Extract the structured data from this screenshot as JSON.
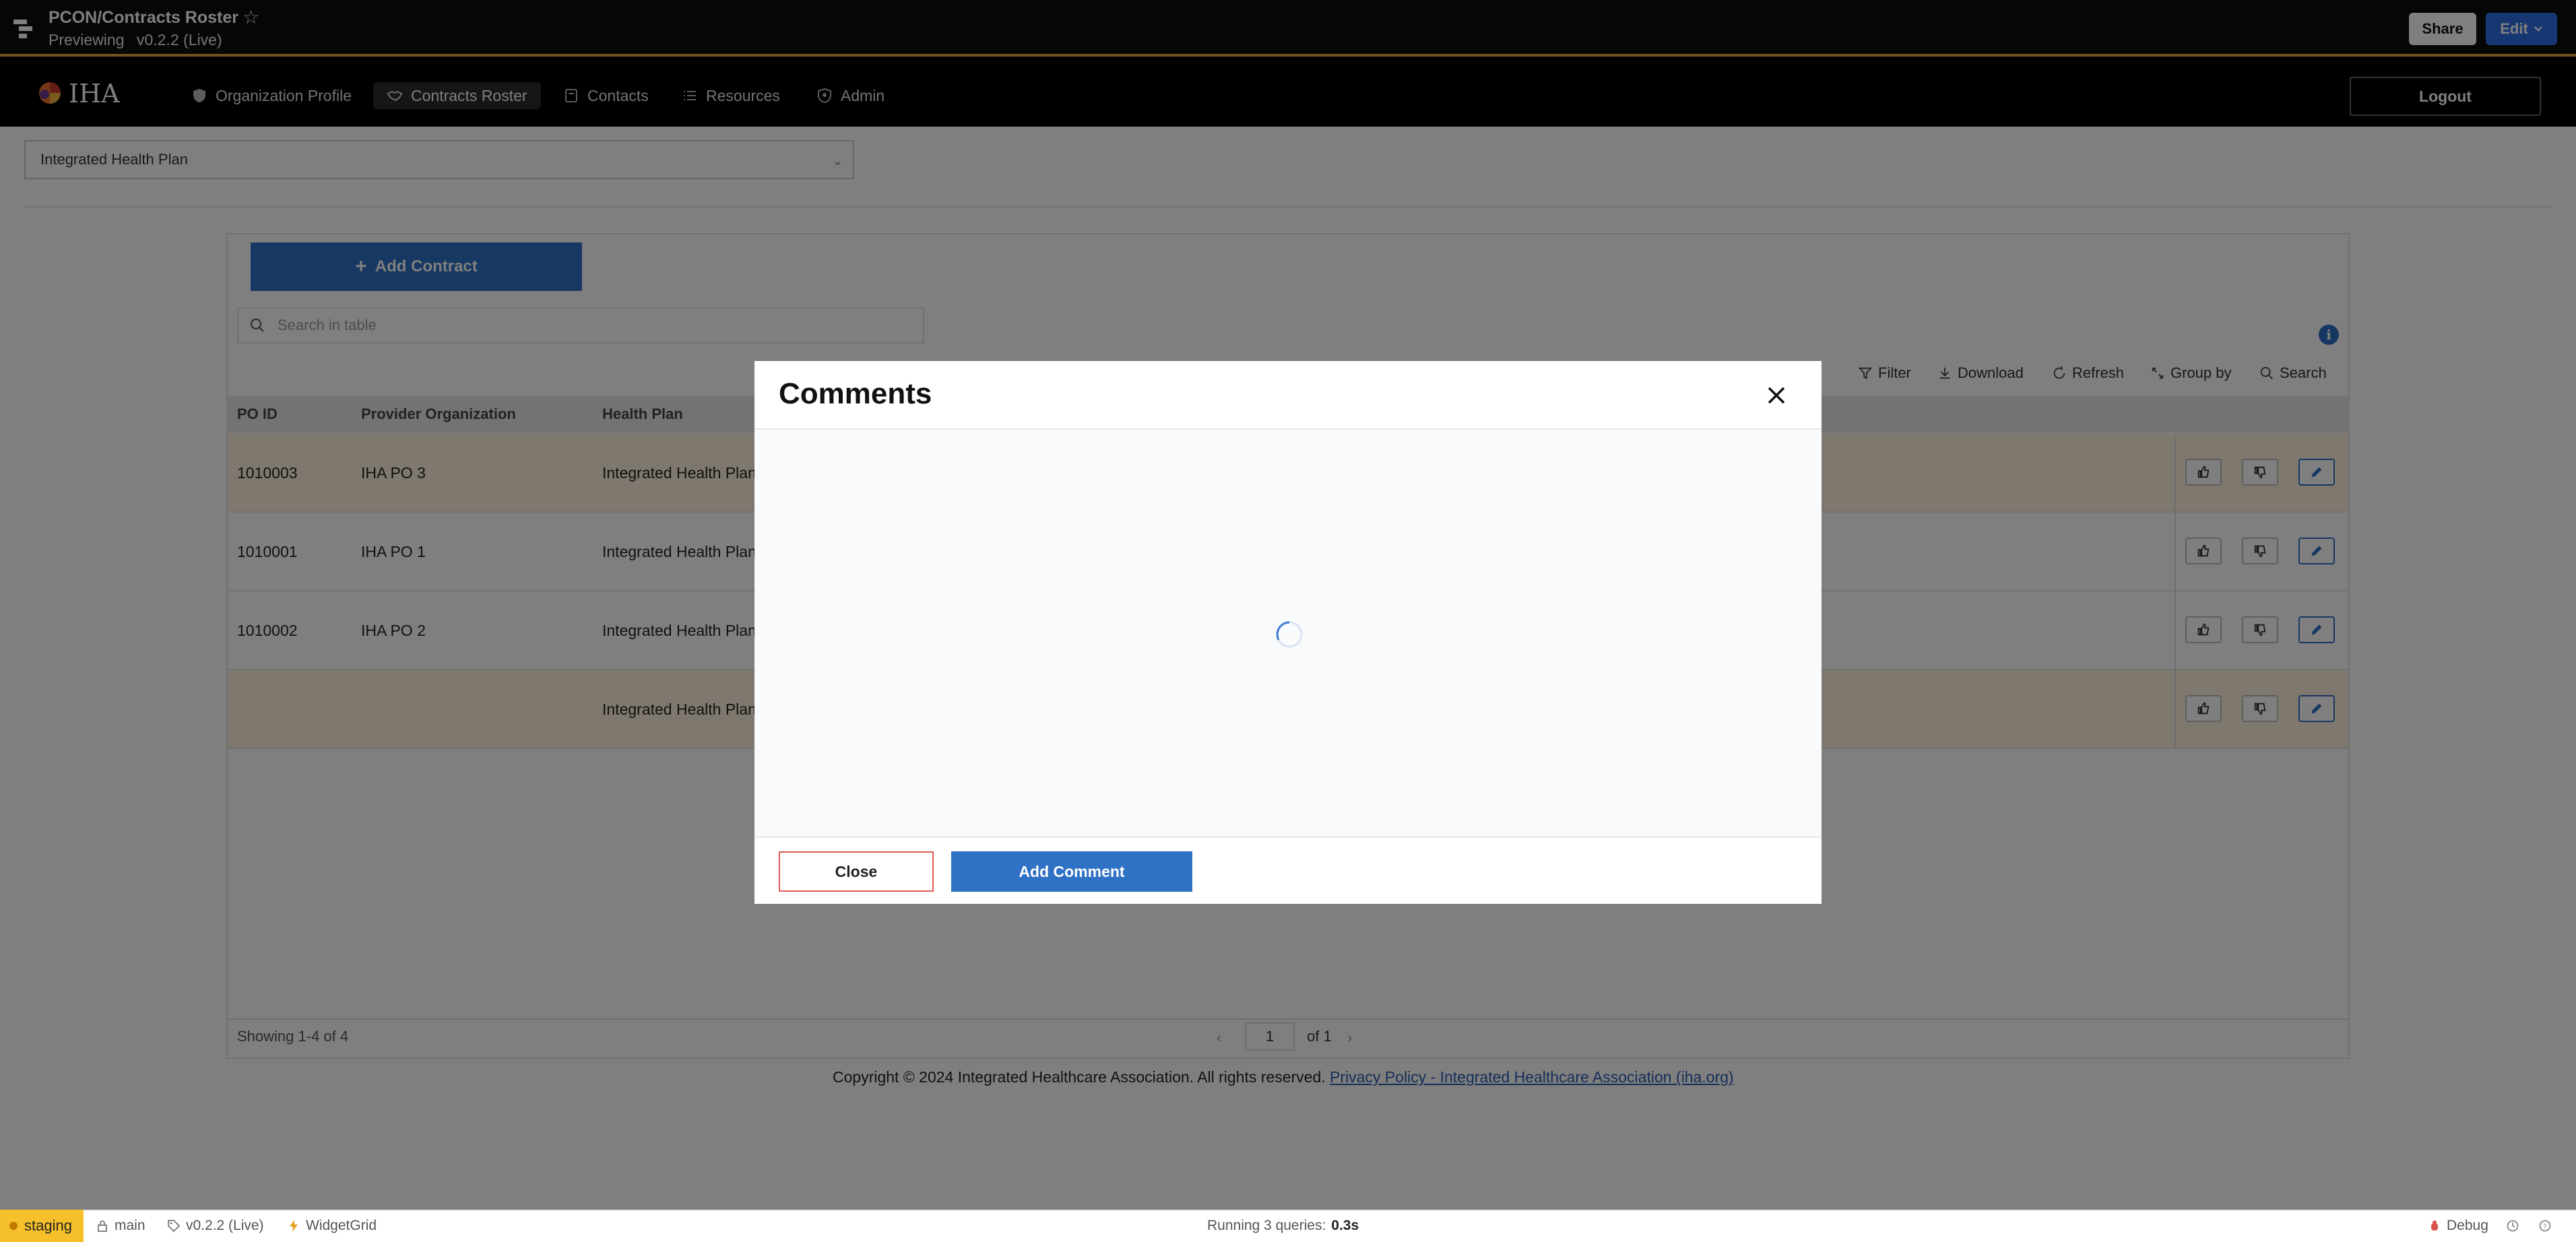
{
  "app": {
    "title": "PCON/Contracts Roster",
    "preview_label": "Previewing",
    "version": "v0.2.2 (Live)",
    "share_label": "Share",
    "edit_label": "Edit",
    "accent_color": "#e9a23b"
  },
  "nav": {
    "logo_text": "IHA",
    "items": [
      {
        "label": "Organization Profile",
        "icon": "shield-icon"
      },
      {
        "label": "Contracts Roster",
        "icon": "handshake-icon"
      },
      {
        "label": "Contacts",
        "icon": "contact-card-icon"
      },
      {
        "label": "Resources",
        "icon": "list-icon"
      },
      {
        "label": "Admin",
        "icon": "shield-check-icon"
      }
    ],
    "active": "Contracts Roster",
    "logout_label": "Logout"
  },
  "health_plan_select": {
    "value": "Integrated Health Plan"
  },
  "table": {
    "add_contract_label": "Add Contract",
    "search_placeholder": "Search in table",
    "toolbar": [
      "Filter",
      "Download",
      "Refresh",
      "Group by",
      "Search"
    ],
    "columns": [
      "PO ID",
      "Provider Organization",
      "Health Plan"
    ],
    "rows": [
      {
        "po_id": "1010003",
        "provider": "IHA PO 3",
        "health_plan": "Integrated Health Plan",
        "highlight": true
      },
      {
        "po_id": "1010001",
        "provider": "IHA PO 1",
        "health_plan": "Integrated Health Plan",
        "highlight": false
      },
      {
        "po_id": "1010002",
        "provider": "IHA PO 2",
        "health_plan": "Integrated Health Plan",
        "highlight": false
      },
      {
        "po_id": "",
        "provider": "",
        "health_plan": "Integrated Health Plan",
        "highlight": true
      }
    ],
    "showing": "Showing 1-4 of 4",
    "page": "1",
    "of_pages": "of 1"
  },
  "footer": {
    "copyright": "Copyright © 2024 Integrated Healthcare Association. All rights reserved.",
    "link_text": "Privacy Policy - Integrated Healthcare Association (iha.org)"
  },
  "modal": {
    "title": "Comments",
    "close_label": "Close",
    "add_comment_label": "Add Comment"
  },
  "statusbar": {
    "env": "staging",
    "branch": "main",
    "version": "v0.2.2 (Live)",
    "widget": "WidgetGrid",
    "running_label": "Running 3 queries:",
    "running_time": "0.3s",
    "debug_label": "Debug"
  }
}
